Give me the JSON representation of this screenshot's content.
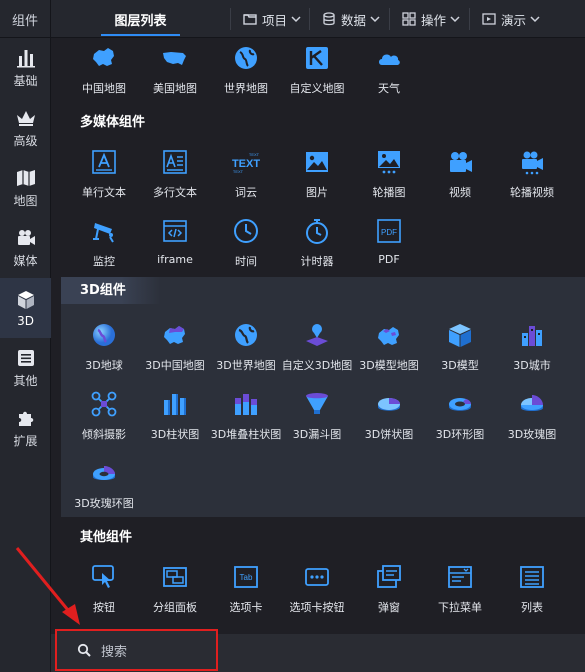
{
  "topbar": {
    "components_label": "组件",
    "layers_tab": "图层列表",
    "menus": [
      {
        "label": "项目",
        "icon": "folder-icon"
      },
      {
        "label": "数据",
        "icon": "database-icon"
      },
      {
        "label": "操作",
        "icon": "grid-icon"
      },
      {
        "label": "演示",
        "icon": "present-icon"
      }
    ]
  },
  "sidebar": {
    "items": [
      {
        "label": "基础",
        "icon": "bar-chart-icon"
      },
      {
        "label": "高级",
        "icon": "crown-icon"
      },
      {
        "label": "地图",
        "icon": "map-icon"
      },
      {
        "label": "媒体",
        "icon": "camera-icon"
      },
      {
        "label": "3D",
        "icon": "cube-icon"
      },
      {
        "label": "其他",
        "icon": "list-icon"
      },
      {
        "label": "扩展",
        "icon": "puzzle-icon"
      }
    ]
  },
  "map_items": [
    {
      "label": "中国地图",
      "icon": "china-map-icon"
    },
    {
      "label": "美国地图",
      "icon": "usa-map-icon"
    },
    {
      "label": "世界地图",
      "icon": "globe-icon"
    },
    {
      "label": "自定义地图",
      "icon": "custom-map-icon"
    },
    {
      "label": "天气",
      "icon": "cloud-icon"
    }
  ],
  "multimedia": {
    "title": "多媒体组件",
    "items": [
      {
        "label": "单行文本",
        "icon": "single-text-icon"
      },
      {
        "label": "多行文本",
        "icon": "multi-text-icon"
      },
      {
        "label": "词云",
        "icon": "word-cloud-icon"
      },
      {
        "label": "图片",
        "icon": "image-icon"
      },
      {
        "label": "轮播图",
        "icon": "carousel-icon"
      },
      {
        "label": "视频",
        "icon": "video-icon"
      },
      {
        "label": "轮播视频",
        "icon": "carousel-video-icon"
      },
      {
        "label": "监控",
        "icon": "cctv-icon"
      },
      {
        "label": "iframe",
        "icon": "code-icon"
      },
      {
        "label": "时间",
        "icon": "clock-icon"
      },
      {
        "label": "计时器",
        "icon": "stopwatch-icon"
      },
      {
        "label": "PDF",
        "icon": "pdf-icon"
      }
    ]
  },
  "three_d": {
    "title": "3D组件",
    "items": [
      {
        "label": "3D地球",
        "icon": "3d-earth-icon"
      },
      {
        "label": "3D中国地图",
        "icon": "3d-china-map-icon"
      },
      {
        "label": "3D世界地图",
        "icon": "3d-world-map-icon"
      },
      {
        "label": "自定义3D地图",
        "icon": "3d-custom-map-icon"
      },
      {
        "label": "3D模型地图",
        "icon": "3d-model-map-icon"
      },
      {
        "label": "3D模型",
        "icon": "3d-model-icon"
      },
      {
        "label": "3D城市",
        "icon": "3d-city-icon"
      },
      {
        "label": "倾斜摄影",
        "icon": "drone-icon"
      },
      {
        "label": "3D柱状图",
        "icon": "3d-bar-icon"
      },
      {
        "label": "3D堆叠柱状图",
        "icon": "3d-stacked-bar-icon"
      },
      {
        "label": "3D漏斗图",
        "icon": "3d-funnel-icon"
      },
      {
        "label": "3D饼状图",
        "icon": "3d-pie-icon"
      },
      {
        "label": "3D环形图",
        "icon": "3d-ring-icon"
      },
      {
        "label": "3D玫瑰图",
        "icon": "3d-rose-icon"
      },
      {
        "label": "3D玫瑰环图",
        "icon": "3d-rose-ring-icon"
      }
    ]
  },
  "other": {
    "title": "其他组件",
    "items": [
      {
        "label": "按钮",
        "icon": "button-icon"
      },
      {
        "label": "分组面板",
        "icon": "group-panel-icon"
      },
      {
        "label": "选项卡",
        "icon": "tab-icon"
      },
      {
        "label": "选项卡按钮",
        "icon": "tab-button-icon"
      },
      {
        "label": "弹窗",
        "icon": "popup-icon"
      },
      {
        "label": "下拉菜单",
        "icon": "dropdown-icon"
      },
      {
        "label": "列表",
        "icon": "list-component-icon"
      }
    ]
  },
  "search": {
    "placeholder": "搜索"
  },
  "colors": {
    "accent": "#2f8cf5",
    "icon_blue": "#3fa0ff",
    "highlight_red": "#e01f1f"
  }
}
